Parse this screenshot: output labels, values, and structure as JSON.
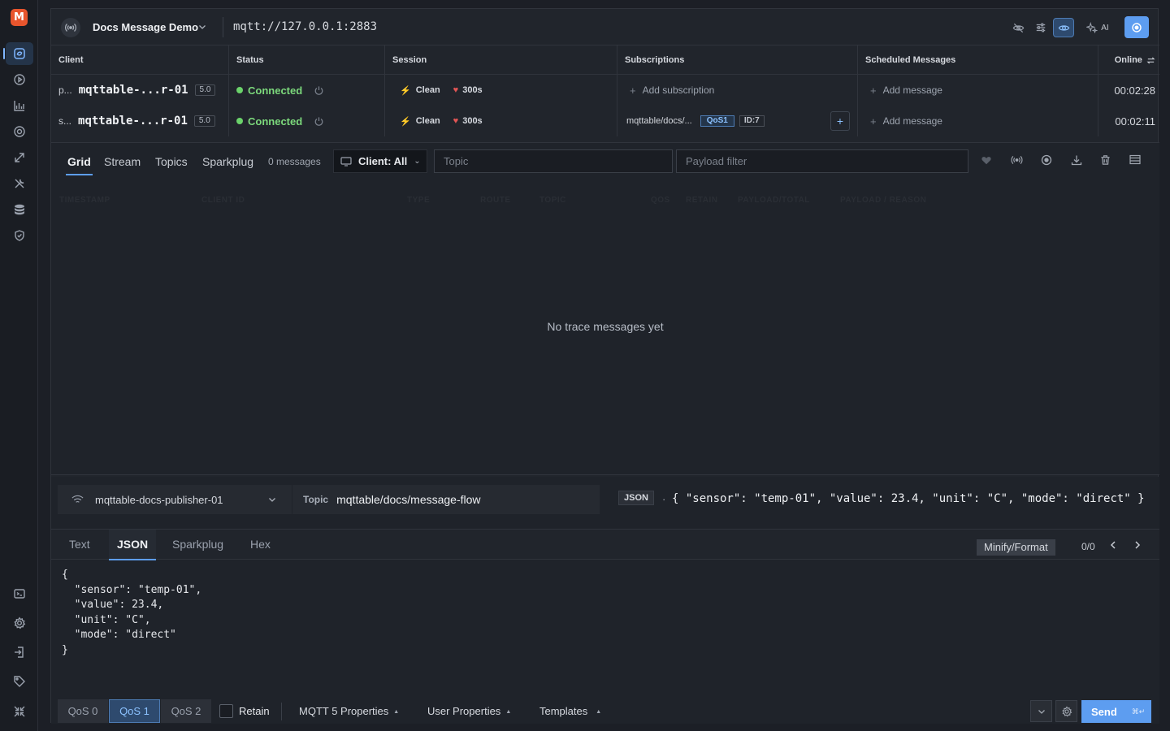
{
  "app": {
    "logo_letter": "M",
    "connection_name": "Docs Message Demo",
    "url": "mqtt://127.0.0.1:2883",
    "ai_label": "AI"
  },
  "rail": {
    "top_icons": [
      "connections-icon",
      "play-circle-icon",
      "chart-icon",
      "target-icon",
      "broadcast-icon",
      "tools-icon",
      "database-icon",
      "shield-icon"
    ],
    "bottom_icons": [
      "terminal-icon",
      "settings-icon",
      "login-icon",
      "tag-icon",
      "collapse-icon"
    ]
  },
  "table": {
    "headers": [
      "Client",
      "Status",
      "Session",
      "Subscriptions",
      "Scheduled Messages",
      "Online"
    ],
    "rows": [
      {
        "prefix": "p...",
        "client": "mqttable-...r-01",
        "version": "5.0",
        "status": "Connected",
        "clean": "Clean",
        "ttl": "300s",
        "subscription_action": "Add subscription",
        "scheduled_action": "Add message",
        "online": "00:02:28"
      },
      {
        "prefix": "s...",
        "client": "mqttable-...r-01",
        "version": "5.0",
        "status": "Connected",
        "clean": "Clean",
        "ttl": "300s",
        "subscription_topic": "mqttable/docs/...",
        "subscription_qos": "QoS1",
        "subscription_id": "ID:7",
        "scheduled_action": "Add message",
        "online": "00:02:11"
      }
    ]
  },
  "trace": {
    "tabs": [
      "Grid",
      "Stream",
      "Topics",
      "Sparkplug"
    ],
    "active_tab": "Grid",
    "message_count": "0 messages",
    "client_filter": "Client: All",
    "topic_placeholder": "Topic",
    "payload_placeholder": "Payload filter",
    "columns": [
      "TIMESTAMP",
      "CLIENT ID",
      "TYPE",
      "ROUTE",
      "TOPIC",
      "QOS",
      "RETAIN",
      "PAYLOAD/TOTAL",
      "PAYLOAD / REASON"
    ],
    "empty_text": "No trace messages yet"
  },
  "composer": {
    "publisher": "mqttable-docs-publisher-01",
    "topic_label": "Topic",
    "topic": "mqttable/docs/message-flow",
    "format_badge": "JSON",
    "preview": "{ \"sensor\": \"temp-01\", \"value\": 23.4, \"unit\": \"C\", \"mode\": \"direct\" }",
    "editor_tabs": [
      "Text",
      "JSON",
      "Sparkplug",
      "Hex"
    ],
    "active_editor_tab": "JSON",
    "minify_label": "Minify/Format",
    "match_count": "0/0",
    "code": "{\n  \"sensor\": \"temp-01\",\n  \"value\": 23.4,\n  \"unit\": \"C\",\n  \"mode\": \"direct\"\n}",
    "qos_options": [
      "QoS 0",
      "QoS 1",
      "QoS 2"
    ],
    "active_qos": "QoS 1",
    "retain_label": "Retain",
    "mqtt5_label": "MQTT 5 Properties",
    "user_props_label": "User Properties",
    "templates_label": "Templates",
    "send_label": "Send",
    "send_shortcut": "⌘↵"
  },
  "colors": {
    "accent": "#5d9df0",
    "connected": "#6bd36b",
    "logo": "#e8552d"
  }
}
